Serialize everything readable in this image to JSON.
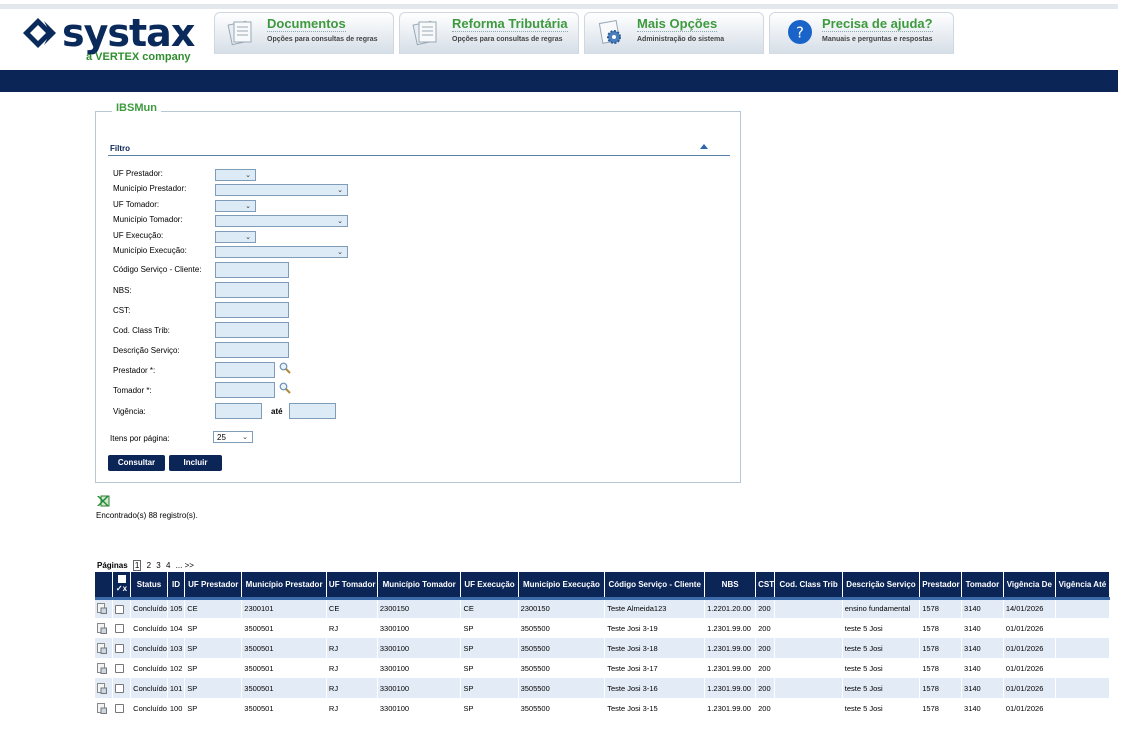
{
  "brand": {
    "name": "systax",
    "tagline": "a VERTEX company"
  },
  "nav": [
    {
      "title": "Documentos",
      "subtitle": "Opções para consultas de regras",
      "icon": "document-icon"
    },
    {
      "title": "Reforma Tributária",
      "subtitle": "Opções para consultas de regras",
      "icon": "document-icon"
    },
    {
      "title": "Mais Opções",
      "subtitle": "Administração do sistema",
      "icon": "gear-icon"
    },
    {
      "title": "Precisa de ajuda?",
      "subtitle": "Manuais e perguntas e respostas",
      "icon": "help-icon"
    }
  ],
  "panel": {
    "title": "IBSMun",
    "section": "Filtro"
  },
  "filters": {
    "uf_prestador": "UF Prestador:",
    "municipio_prestador": "Município Prestador:",
    "uf_tomador": "UF Tomador:",
    "municipio_tomador": "Município Tomador:",
    "uf_execucao": "UF Execução:",
    "municipio_execucao": "Município Execução:",
    "codigo_servico": "Código Serviço - Cliente:",
    "nbs": "NBS:",
    "cst": "CST:",
    "cod_class_trib": "Cod. Class Trib:",
    "descricao_servico": "Descrição Serviço:",
    "prestador": "Prestador *:",
    "tomador": "Tomador *:",
    "vigencia": "Vigência:",
    "ate": "até",
    "itens_por_pagina": "Itens por página:",
    "itens_por_pagina_value": "25"
  },
  "buttons": {
    "consultar": "Consultar",
    "incluir": "Incluir"
  },
  "results": {
    "found_text": "Encontrado(s) 88 registro(s).",
    "pages_label": "Páginas",
    "pages": [
      "1",
      "2",
      "3",
      "4"
    ],
    "pages_more": "... >>",
    "current_page": "1"
  },
  "table": {
    "columns": [
      "Status",
      "ID",
      "UF Prestador",
      "Município Prestador",
      "UF Tomador",
      "Município Tomador",
      "UF Execução",
      "Município Execução",
      "Código Serviço - Cliente",
      "NBS",
      "CST",
      "Cod. Class Trib",
      "Descrição Serviço",
      "Prestador",
      "Tomador",
      "Vigência De",
      "Vigência Até"
    ],
    "rows": [
      [
        "Concluído",
        "105",
        "CE",
        "2300101",
        "CE",
        "2300150",
        "CE",
        "2300150",
        "Teste Almeida123",
        "1.2201.20.00",
        "200",
        "",
        "ensino fundamental",
        "1578",
        "3140",
        "14/01/2026",
        ""
      ],
      [
        "Concluído",
        "104",
        "SP",
        "3500501",
        "RJ",
        "3300100",
        "SP",
        "3505500",
        "Teste Josi 3-19",
        "1.2301.99.00",
        "200",
        "",
        "teste 5 Josi",
        "1578",
        "3140",
        "01/01/2026",
        ""
      ],
      [
        "Concluído",
        "103",
        "SP",
        "3500501",
        "RJ",
        "3300100",
        "SP",
        "3505500",
        "Teste Josi 3-18",
        "1.2301.99.00",
        "200",
        "",
        "teste 5 Josi",
        "1578",
        "3140",
        "01/01/2026",
        ""
      ],
      [
        "Concluído",
        "102",
        "SP",
        "3500501",
        "RJ",
        "3300100",
        "SP",
        "3505500",
        "Teste Josi 3-17",
        "1.2301.99.00",
        "200",
        "",
        "teste 5 Josi",
        "1578",
        "3140",
        "01/01/2026",
        ""
      ],
      [
        "Concluído",
        "101",
        "SP",
        "3500501",
        "RJ",
        "3300100",
        "SP",
        "3505500",
        "Teste Josi 3-16",
        "1.2301.99.00",
        "200",
        "",
        "teste 5 Josi",
        "1578",
        "3140",
        "01/01/2026",
        ""
      ],
      [
        "Concluído",
        "100",
        "SP",
        "3500501",
        "RJ",
        "3300100",
        "SP",
        "3505500",
        "Teste Josi 3-15",
        "1.2301.99.00",
        "200",
        "",
        "teste 5 Josi",
        "1578",
        "3140",
        "01/01/2026",
        ""
      ]
    ]
  },
  "colors": {
    "navy": "#0b2557",
    "green": "#3e9a3e",
    "field_bg": "#ddebf7",
    "row_alt": "#e3ecf6"
  }
}
